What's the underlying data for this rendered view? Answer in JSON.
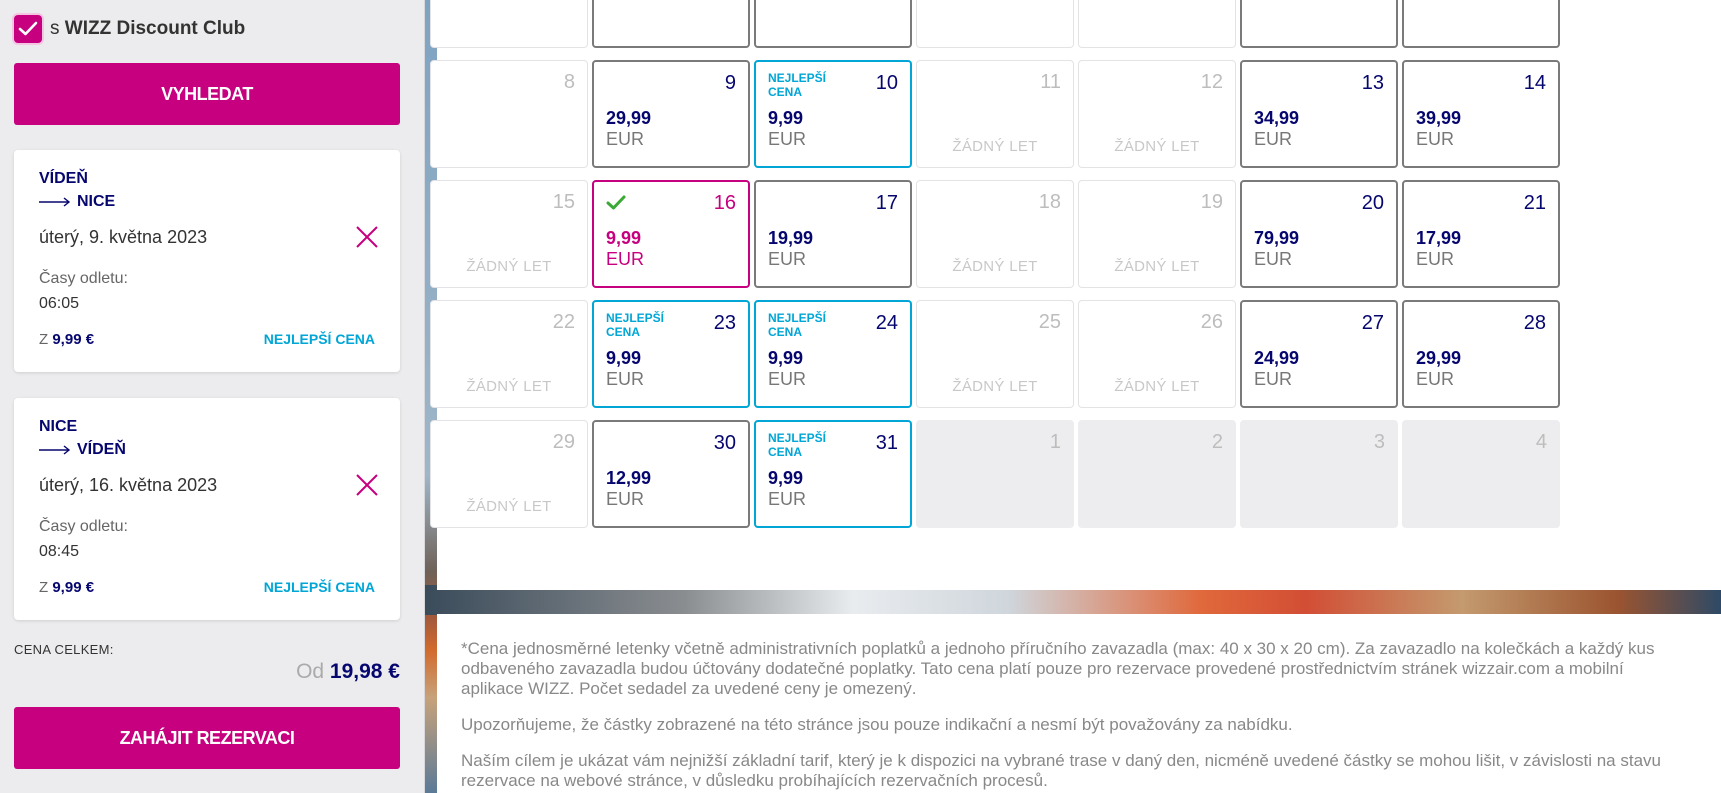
{
  "sidebar": {
    "club_prefix": "s",
    "club_name": "WIZZ Discount Club",
    "search_button": "VYHLEDAT",
    "legs": [
      {
        "from": "VÍDEŇ",
        "to": "NICE",
        "date": "úterý, 9. května 2023",
        "times_label": "Časy odletu:",
        "time": "06:05",
        "price_prefix": "Z",
        "price": "9,99 €",
        "best_label": "NEJLEPŠÍ CENA"
      },
      {
        "from": "NICE",
        "to": "VÍDEŇ",
        "date": "úterý, 16. května 2023",
        "times_label": "Časy odletu:",
        "time": "08:45",
        "price_prefix": "Z",
        "price": "9,99 €",
        "best_label": "NEJLEPŠÍ CENA"
      }
    ],
    "total_label": "CENA CELKEM:",
    "total_prefix": "Od",
    "total_amount": "19,98 €",
    "book_button": "ZAHÁJIT REZERVACI"
  },
  "calendar": {
    "no_flight_label": "ŽÁDNÝ LET",
    "best_price_label": "NEJLEPŠÍ CENA",
    "currency": "EUR",
    "rows": [
      [
        {
          "day": "",
          "status": "empty"
        },
        {
          "day": "",
          "status": "active"
        },
        {
          "day": "",
          "status": "active"
        },
        {
          "day": "",
          "status": "empty"
        },
        {
          "day": "",
          "status": "empty"
        },
        {
          "day": "",
          "status": "active"
        },
        {
          "day": "",
          "status": "active"
        }
      ],
      [
        {
          "day": "8",
          "status": "empty"
        },
        {
          "day": "9",
          "status": "active",
          "price": "29,99"
        },
        {
          "day": "10",
          "status": "best",
          "price": "9,99"
        },
        {
          "day": "11",
          "status": "noflight"
        },
        {
          "day": "12",
          "status": "noflight"
        },
        {
          "day": "13",
          "status": "active",
          "price": "34,99"
        },
        {
          "day": "14",
          "status": "active",
          "price": "39,99"
        }
      ],
      [
        {
          "day": "15",
          "status": "noflight"
        },
        {
          "day": "16",
          "status": "selected",
          "price": "9,99"
        },
        {
          "day": "17",
          "status": "active",
          "price": "19,99"
        },
        {
          "day": "18",
          "status": "noflight"
        },
        {
          "day": "19",
          "status": "noflight"
        },
        {
          "day": "20",
          "status": "active",
          "price": "79,99"
        },
        {
          "day": "21",
          "status": "active",
          "price": "17,99"
        }
      ],
      [
        {
          "day": "22",
          "status": "noflight"
        },
        {
          "day": "23",
          "status": "best",
          "price": "9,99"
        },
        {
          "day": "24",
          "status": "best",
          "price": "9,99"
        },
        {
          "day": "25",
          "status": "noflight"
        },
        {
          "day": "26",
          "status": "noflight"
        },
        {
          "day": "27",
          "status": "active",
          "price": "24,99"
        },
        {
          "day": "28",
          "status": "active",
          "price": "29,99"
        }
      ],
      [
        {
          "day": "29",
          "status": "noflight"
        },
        {
          "day": "30",
          "status": "active",
          "price": "12,99"
        },
        {
          "day": "31",
          "status": "best",
          "price": "9,99"
        },
        {
          "day": "1",
          "status": "grey"
        },
        {
          "day": "2",
          "status": "grey"
        },
        {
          "day": "3",
          "status": "grey"
        },
        {
          "day": "4",
          "status": "grey"
        }
      ]
    ]
  },
  "disclaimer": {
    "p1": "*Cena jednosměrné letenky včetně administrativních poplatků a jednoho příručního zavazadla (max: 40 x 30 x 20 cm). Za zavazadlo na kolečkách a každý kus odbaveného zavazadla budou účtovány dodatečné poplatky. Tato cena platí pouze pro rezervace provedené prostřednictvím stránek wizzair.com a mobilní aplikace WIZZ. Počet sedadel za uvedené ceny je omezený.",
    "p2": "Upozorňujeme, že částky zobrazené na této stránce jsou pouze indikační a nesmí být považovány za nabídku.",
    "p3": "Naším cílem je ukázat vám nejnižší základní tarif, který je k dispozici na vybrané trase v daný den, nicméně uvedené částky se mohou lišit, v závislosti na stavu rezervace na webové stránce, v důsledku probíhajících rezervačních procesů."
  },
  "colors": {
    "brand": "#c6007e",
    "navy": "#06066f",
    "best": "#00a6d6",
    "check": "#3aa935"
  }
}
